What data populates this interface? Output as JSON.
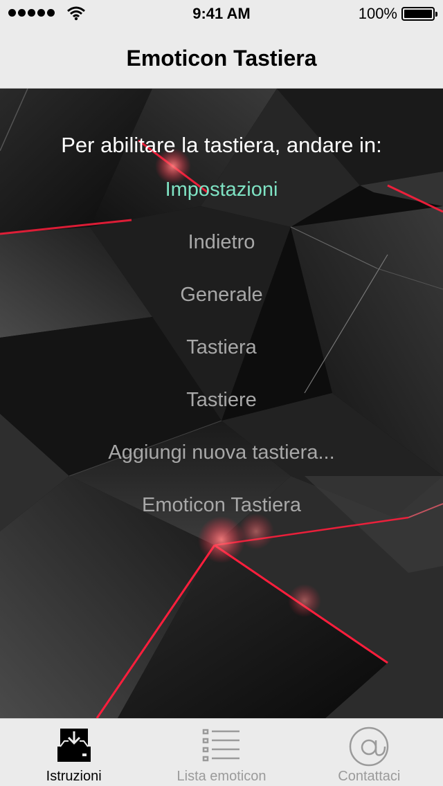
{
  "status_bar": {
    "time": "9:41 AM",
    "battery": "100%",
    "signal_icon": "signal-dots-icon",
    "wifi_icon": "wifi-icon",
    "battery_icon": "battery-icon"
  },
  "nav": {
    "title": "Emoticon Tastiera"
  },
  "instructions": {
    "heading": "Per abilitare la tastiera, andare in:",
    "steps": [
      "Impostazioni",
      "Indietro",
      "Generale",
      "Tastiera",
      "Tastiere",
      "Aggiungi nuova tastiera...",
      "Emoticon Tastiera"
    ]
  },
  "tabbar": {
    "tabs": [
      {
        "label": "Istruzioni",
        "icon": "download-tray-icon"
      },
      {
        "label": "Lista emoticon",
        "icon": "list-icon"
      },
      {
        "label": "Contattaci",
        "icon": "at-sign-icon"
      }
    ]
  },
  "colors": {
    "accent_step": "#7fe3c4",
    "step_text": "#a8a8a8",
    "bar_background": "#ebebeb",
    "glow": "#ff1e3c"
  }
}
